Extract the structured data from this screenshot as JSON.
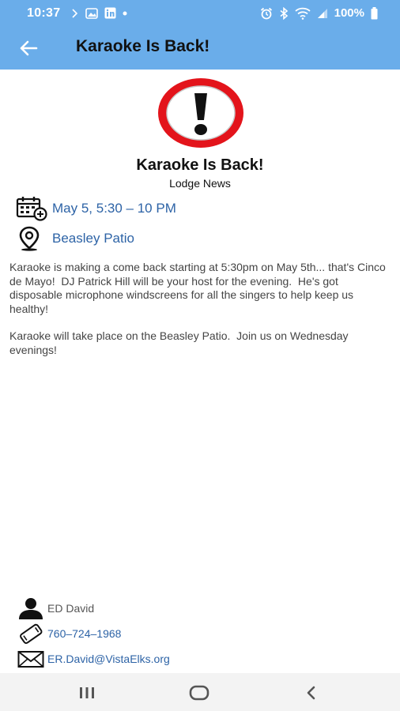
{
  "status_bar": {
    "time": "10:37",
    "battery": "100%"
  },
  "app_bar": {
    "title": "Karaoke Is Back!"
  },
  "post": {
    "title": "Karaoke Is Back!",
    "category": "Lodge News",
    "date_text": "May 5, 5:30 – 10 PM",
    "location_text": "Beasley Patio",
    "paragraphs": [
      "Karaoke is making a come back starting at 5:30pm on May 5th... that's Cinco de Mayo!  DJ Patrick Hill will be your host for the evening.  He's got disposable microphone windscreens for all the singers to help keep us healthy!",
      "Karaoke will take place on the Beasley Patio.  Join us on Wednesday evenings!"
    ]
  },
  "contact": {
    "name": "ED David",
    "phone": "760–724–1968",
    "email": "ER.David@VistaElks.org"
  },
  "colors": {
    "app_bar": "#6aadea",
    "link": "#2d63a6",
    "alert_red": "#e3141b"
  },
  "icons": {
    "back": "arrow-left-icon",
    "calendar": "calendar-add-icon",
    "location": "map-pin-icon",
    "person": "person-icon",
    "phone": "phone-icon",
    "email": "envelope-icon"
  }
}
